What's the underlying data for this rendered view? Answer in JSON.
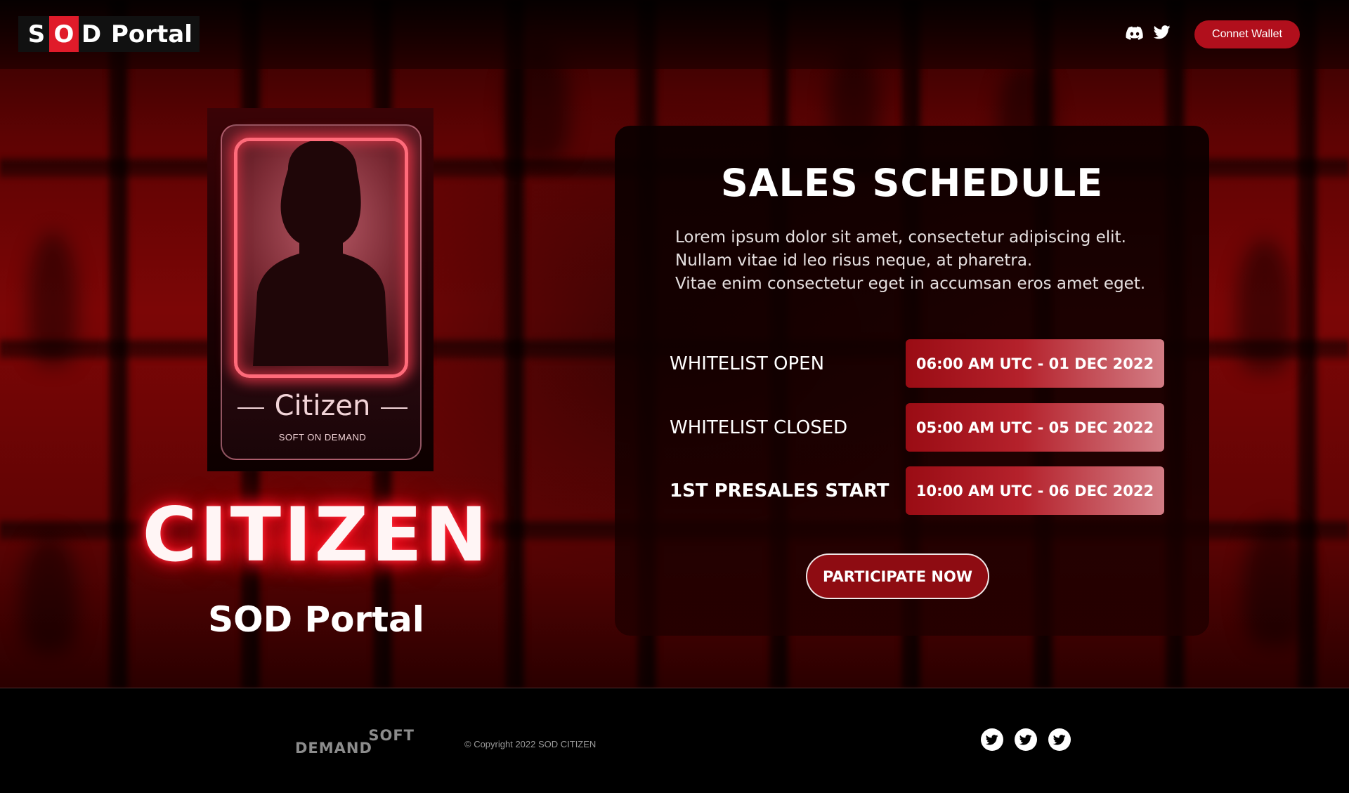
{
  "header": {
    "logo": {
      "s": "S",
      "o": "O",
      "d": "D",
      "portal": "Portal"
    },
    "icons": [
      "discord-icon",
      "twitter-icon"
    ],
    "connect_wallet_label": "Connet Wallet"
  },
  "card": {
    "name": "Citizen",
    "subtitle": "SOFT ON DEMAND"
  },
  "hero": {
    "title": "CITIZEN",
    "subtitle": "SOD Portal"
  },
  "sales": {
    "title": "SALES SCHEDULE",
    "description": [
      "Lorem ipsum dolor sit amet, consectetur adipiscing elit.",
      "Nullam vitae id leo risus neque, at pharetra.",
      "Vitae enim consectetur eget in accumsan eros amet eget."
    ],
    "schedule": [
      {
        "label": "WHITELIST OPEN",
        "time": "06:00 AM UTC - 01 DEC 2022"
      },
      {
        "label": "WHITELIST CLOSED",
        "time": "05:00 AM UTC - 05 DEC 2022"
      },
      {
        "label": "1ST PRESALES START",
        "time": "10:00 AM UTC - 06 DEC 2022"
      }
    ],
    "participate_label": "PARTICIPATE NOW"
  },
  "footer": {
    "logo_line1": "SOFT",
    "logo_line2": "DEMAND",
    "copyright": "© Copyright 2022 SOD CITIZEN",
    "icons": [
      "twitter-icon",
      "twitter-icon",
      "twitter-icon"
    ]
  },
  "colors": {
    "accent": "#b10f1c",
    "logo_red": "#e01b2a",
    "background": "#000000"
  }
}
